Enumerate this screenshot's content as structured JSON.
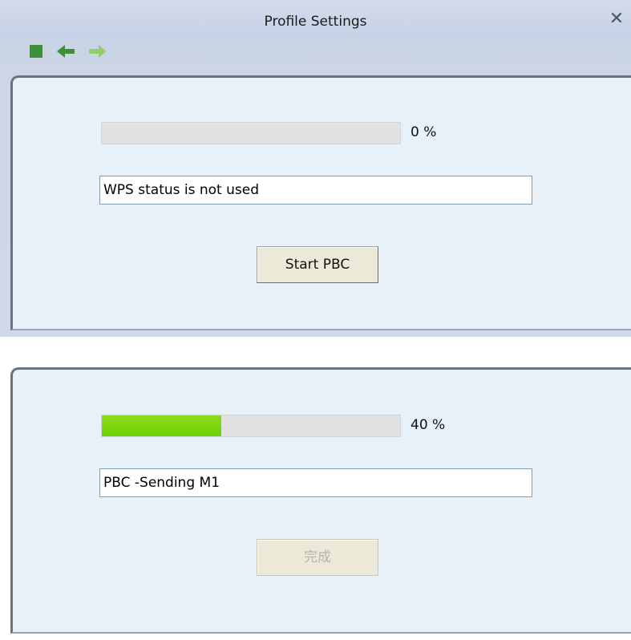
{
  "window": {
    "title": "Profile Settings",
    "close_symbol": "✕",
    "toolbar": [
      {
        "icon": "stop-icon",
        "color": "#3f8f3a"
      },
      {
        "icon": "back-arrow-icon",
        "color": "#3f8f3a"
      },
      {
        "icon": "forward-arrow-icon",
        "color": "#8fd06a"
      }
    ]
  },
  "panel_before": {
    "progress_percent": 0,
    "percent_label": "0 %",
    "status_text": "WPS status is not used",
    "button_label": "Start PBC",
    "button_enabled": true
  },
  "panel_after": {
    "progress_percent": 40,
    "percent_label": "40 %",
    "status_text": "PBC -Sending M1",
    "button_label": "完成",
    "button_enabled": false,
    "progress_color": "#7ad60d"
  }
}
